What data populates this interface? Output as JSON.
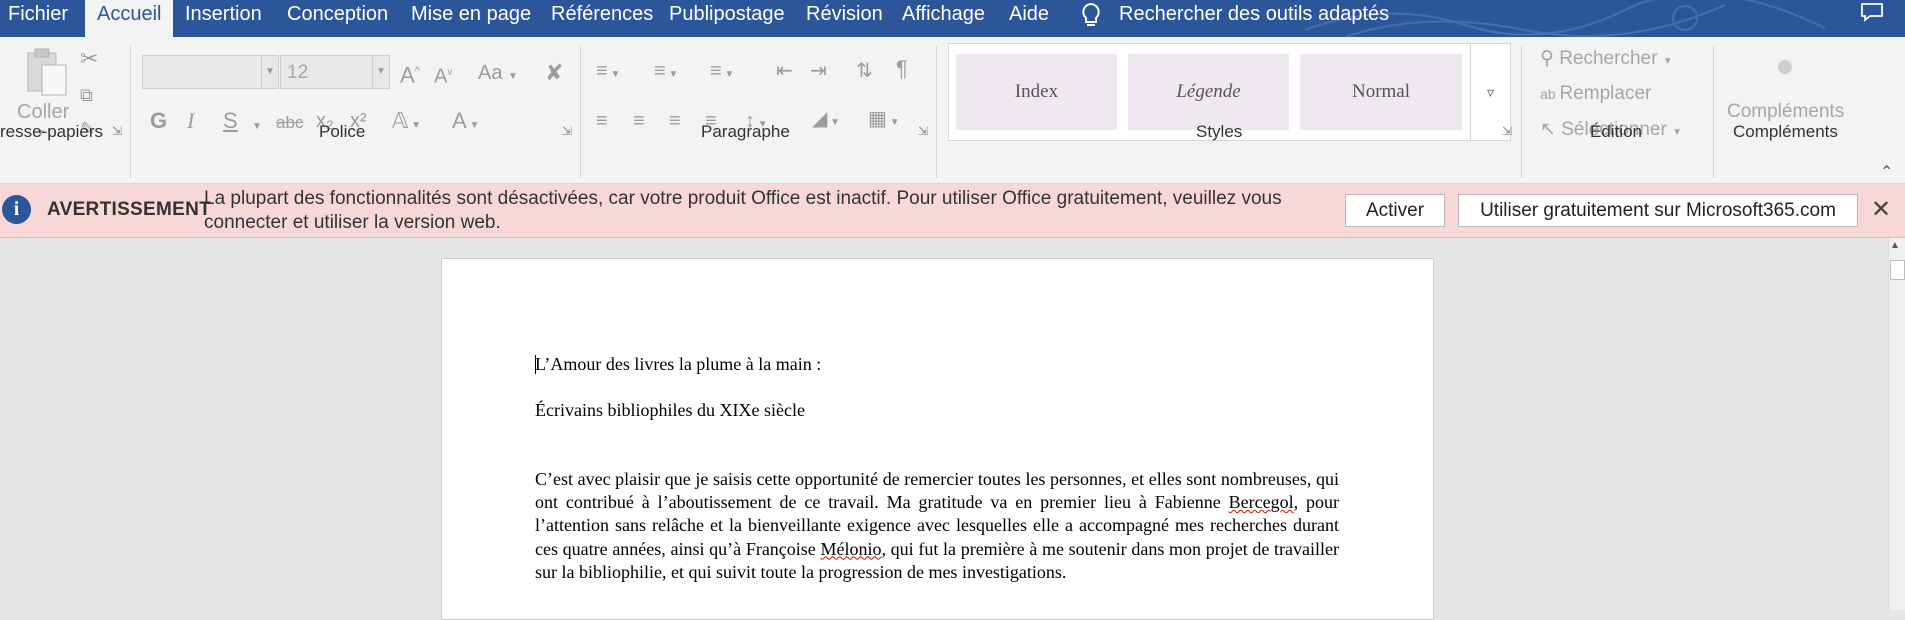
{
  "menu": {
    "items": [
      "Fichier",
      "Accueil",
      "Insertion",
      "Conception",
      "Mise en page",
      "Références",
      "Publipostage",
      "Révision",
      "Affichage",
      "Aide"
    ],
    "search_label": "Rechercher des outils adaptés"
  },
  "ribbon": {
    "clipboard": {
      "paste_label": "Coller",
      "group_label": "resse-papiers"
    },
    "font": {
      "font_name": "",
      "font_size": "12",
      "group_label": "Police",
      "case_label": "Aa",
      "bold": "G",
      "italic": "I",
      "underline": "S",
      "strike": "abc",
      "sub": "x₂",
      "sup": "x²"
    },
    "paragraph": {
      "group_label": "Paragraphe",
      "pilcrow": "¶"
    },
    "styles": {
      "group_label": "Styles",
      "tiles": [
        "Index",
        "Légende",
        "Normal"
      ]
    },
    "editing": {
      "group_label": "Édition",
      "search": "Rechercher",
      "replace": "Remplacer",
      "select": "Sélectionner"
    },
    "addins": {
      "label": "Compléments",
      "group_label": "Compléments"
    }
  },
  "warning": {
    "title": "AVERTISSEMENT",
    "text": "La plupart des fonctionnalités sont désactivées, car votre produit Office est inactif. Pour utiliser Office gratuitement, veuillez vous connecter et utiliser la version web.",
    "activate_label": "Activer",
    "web_label": "Utiliser gratuitement sur Microsoft365.com",
    "close_label": "✕"
  },
  "document": {
    "title_line": "L’Amour des livres la plume à la main :",
    "subtitle_line": "Écrivains bibliophiles du XIXe siècle",
    "para_part1": "C’est avec plaisir que je saisis cette opportunité de remercier toutes les personnes, et elles sont nombreuses, qui ont contribué à l’aboutissement de ce travail. Ma gratitude va en premier lieu à Fabienne ",
    "name_bercegol": "Bercegol",
    "para_part2": ", pour l’attention sans relâche et la bienveillante exigence avec lesquelles elle a accompagné mes recherches durant ces quatre années, ainsi qu’à Françoise ",
    "name_melonio": "Mélonio",
    "para_part3": ", qui fut la première à me soutenir dans mon projet de travailler sur la bibliophilie, et qui suivit toute la progression de mes investigations."
  },
  "colors": {
    "word_blue": "#2b579a",
    "warning_bg": "#f8d7d7",
    "page": "#ffffff"
  }
}
